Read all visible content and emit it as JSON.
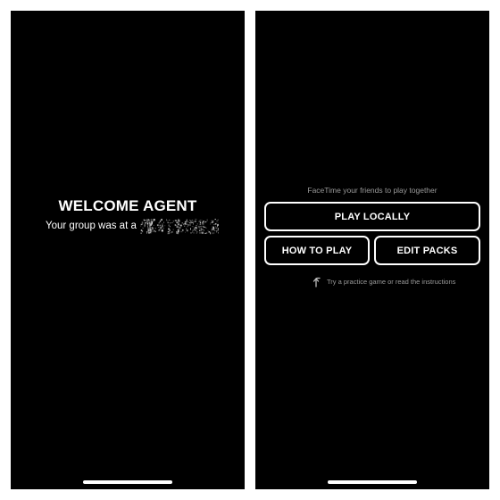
{
  "left_screen": {
    "title": "WELCOME AGENT",
    "group_text": "Your group was at a"
  },
  "right_screen": {
    "facetime_text": "FaceTime your friends to play together",
    "buttons": {
      "play_locally": "PLAY LOCALLY",
      "how_to_play": "HOW TO PLAY",
      "edit_packs": "EDIT PACKS"
    },
    "hint_text": "Try a practice game or read the instructions"
  },
  "icons": {
    "hint": "curved-up-arrow-icon",
    "redacted": "scrambled-text-icon"
  },
  "colors": {
    "background": "#000000",
    "text": "#ffffff",
    "secondary_text": "#9a9a9a",
    "button_border": "#ffffff"
  }
}
